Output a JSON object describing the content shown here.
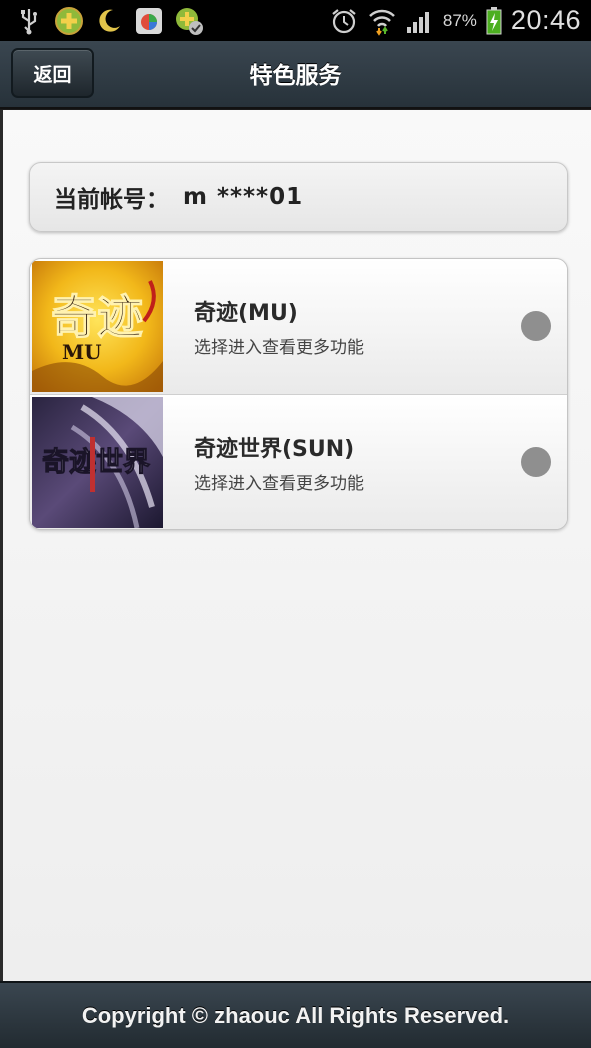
{
  "status_bar": {
    "icons_left": [
      "usb-icon",
      "game-plus-icon",
      "moon-icon",
      "app-icon",
      "game-check-icon"
    ],
    "icons_right": [
      "alarm-icon",
      "wifi-icon",
      "signal-icon",
      "battery-icon"
    ],
    "battery_percent": "87%",
    "time": "20:46"
  },
  "header": {
    "back_label": "返回",
    "title": "特色服务"
  },
  "account": {
    "label": "当前帐号：",
    "value": "m ****01"
  },
  "games": [
    {
      "name": "奇迹(MU)",
      "desc": "选择进入查看更多功能",
      "thumb_text": "奇迹",
      "thumb_sub": "MU"
    },
    {
      "name": "奇迹世界(SUN)",
      "desc": "选择进入查看更多功能",
      "thumb_text": "奇迹世界",
      "thumb_sub": ""
    }
  ],
  "footer": {
    "copyright": "Copyright © zhaouc All Rights Reserved."
  },
  "colors": {
    "header_bg": "#2f3a42",
    "radio": "#8f8f8f",
    "page_bg": "#f2f2f2"
  }
}
